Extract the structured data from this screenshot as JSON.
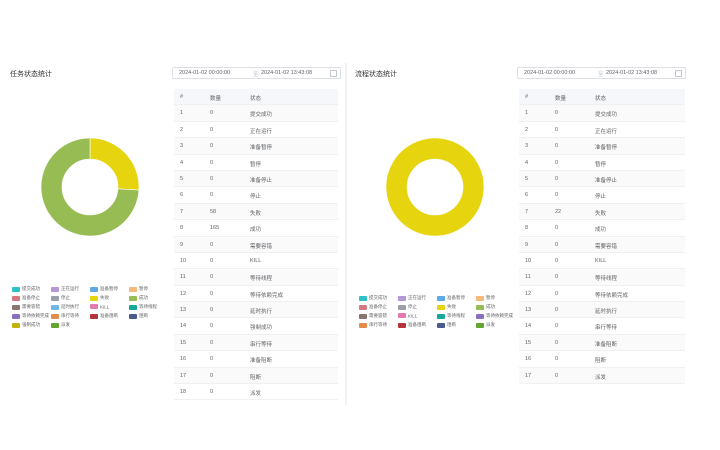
{
  "status_colors": [
    "#2fc1c8",
    "#b497d7",
    "#5ea9e8",
    "#f7b97a",
    "#d4797f",
    "#9a9fa8",
    "#e6d40e",
    "#97bc54",
    "#8a7670",
    "#6db8e6",
    "#e37bb0",
    "#18a899",
    "#8b6fbf",
    "#e58c4b",
    "#b6353c",
    "#4b5c8c",
    "#c1b20c",
    "#62a52f"
  ],
  "task_panel": {
    "title": "任务状态统计",
    "date_start": "2024-01-02 00:00:00",
    "date_sep": "至",
    "date_end": "2024-01-02 13:43:08",
    "table_headers": {
      "index": "#",
      "count": "数量",
      "status": "状态"
    },
    "rows": [
      {
        "index": "1",
        "count": "0",
        "status": "提交成功"
      },
      {
        "index": "2",
        "count": "0",
        "status": "正在运行"
      },
      {
        "index": "3",
        "count": "0",
        "status": "准备暂停"
      },
      {
        "index": "4",
        "count": "0",
        "status": "暂停"
      },
      {
        "index": "5",
        "count": "0",
        "status": "准备停止"
      },
      {
        "index": "6",
        "count": "0",
        "status": "停止"
      },
      {
        "index": "7",
        "count": "58",
        "status": "失败"
      },
      {
        "index": "8",
        "count": "165",
        "status": "成功"
      },
      {
        "index": "9",
        "count": "0",
        "status": "需要容错"
      },
      {
        "index": "10",
        "count": "0",
        "status": "KILL"
      },
      {
        "index": "11",
        "count": "0",
        "status": "等待线程"
      },
      {
        "index": "12",
        "count": "0",
        "status": "等待依赖完成"
      },
      {
        "index": "13",
        "count": "0",
        "status": "延时执行"
      },
      {
        "index": "14",
        "count": "0",
        "status": "强制成功"
      },
      {
        "index": "15",
        "count": "0",
        "status": "串行等待"
      },
      {
        "index": "16",
        "count": "0",
        "status": "准备阻断"
      },
      {
        "index": "17",
        "count": "0",
        "status": "阻断"
      },
      {
        "index": "18",
        "count": "0",
        "status": "派发"
      }
    ],
    "legend": [
      "提交成功",
      "正在运行",
      "准备暂停",
      "暂停",
      "准备停止",
      "停止",
      "失败",
      "成功",
      "需要容错",
      "延时执行",
      "KILL",
      "等待线程",
      "等待依赖完成",
      "串行等待",
      "准备阻断",
      "阻断",
      "强制成功",
      "派发"
    ],
    "legend_color_idx": [
      0,
      1,
      2,
      3,
      4,
      5,
      6,
      7,
      8,
      9,
      10,
      11,
      12,
      13,
      14,
      15,
      16,
      17
    ]
  },
  "process_panel": {
    "title": "流程状态统计",
    "date_start": "2024-01-02 00:00:00",
    "date_sep": "至",
    "date_end": "2024-01-02 13:43:08",
    "table_headers": {
      "index": "#",
      "count": "数量",
      "status": "状态"
    },
    "rows": [
      {
        "index": "1",
        "count": "0",
        "status": "提交成功"
      },
      {
        "index": "2",
        "count": "0",
        "status": "正在运行"
      },
      {
        "index": "3",
        "count": "0",
        "status": "准备暂停"
      },
      {
        "index": "4",
        "count": "0",
        "status": "暂停"
      },
      {
        "index": "5",
        "count": "0",
        "status": "准备停止"
      },
      {
        "index": "6",
        "count": "0",
        "status": "停止"
      },
      {
        "index": "7",
        "count": "22",
        "status": "失败"
      },
      {
        "index": "8",
        "count": "0",
        "status": "成功"
      },
      {
        "index": "9",
        "count": "0",
        "status": "需要容错"
      },
      {
        "index": "10",
        "count": "0",
        "status": "KILL"
      },
      {
        "index": "11",
        "count": "0",
        "status": "等待线程"
      },
      {
        "index": "12",
        "count": "0",
        "status": "等待依赖完成"
      },
      {
        "index": "13",
        "count": "0",
        "status": "延时执行"
      },
      {
        "index": "14",
        "count": "0",
        "status": "串行等待"
      },
      {
        "index": "15",
        "count": "0",
        "status": "准备阻断"
      },
      {
        "index": "16",
        "count": "0",
        "status": "阻断"
      },
      {
        "index": "17",
        "count": "0",
        "status": "派发"
      }
    ],
    "legend": [
      "提交成功",
      "正在运行",
      "准备暂停",
      "暂停",
      "准备停止",
      "停止",
      "失败",
      "成功",
      "需要容错",
      "KILL",
      "等待线程",
      "等待依赖完成",
      "串行等待",
      "准备阻断",
      "阻断",
      "派发"
    ],
    "legend_color_idx": [
      0,
      1,
      2,
      3,
      4,
      5,
      6,
      7,
      8,
      10,
      11,
      12,
      13,
      14,
      15,
      17
    ]
  },
  "chart_data": [
    {
      "type": "pie",
      "donut": true,
      "categories": [
        "失败",
        "成功"
      ],
      "values": [
        58,
        165
      ],
      "colors": [
        "#e6d40e",
        "#97bc54"
      ]
    },
    {
      "type": "pie",
      "donut": true,
      "categories": [
        "失败"
      ],
      "values": [
        22
      ],
      "colors": [
        "#e6d40e"
      ]
    }
  ]
}
